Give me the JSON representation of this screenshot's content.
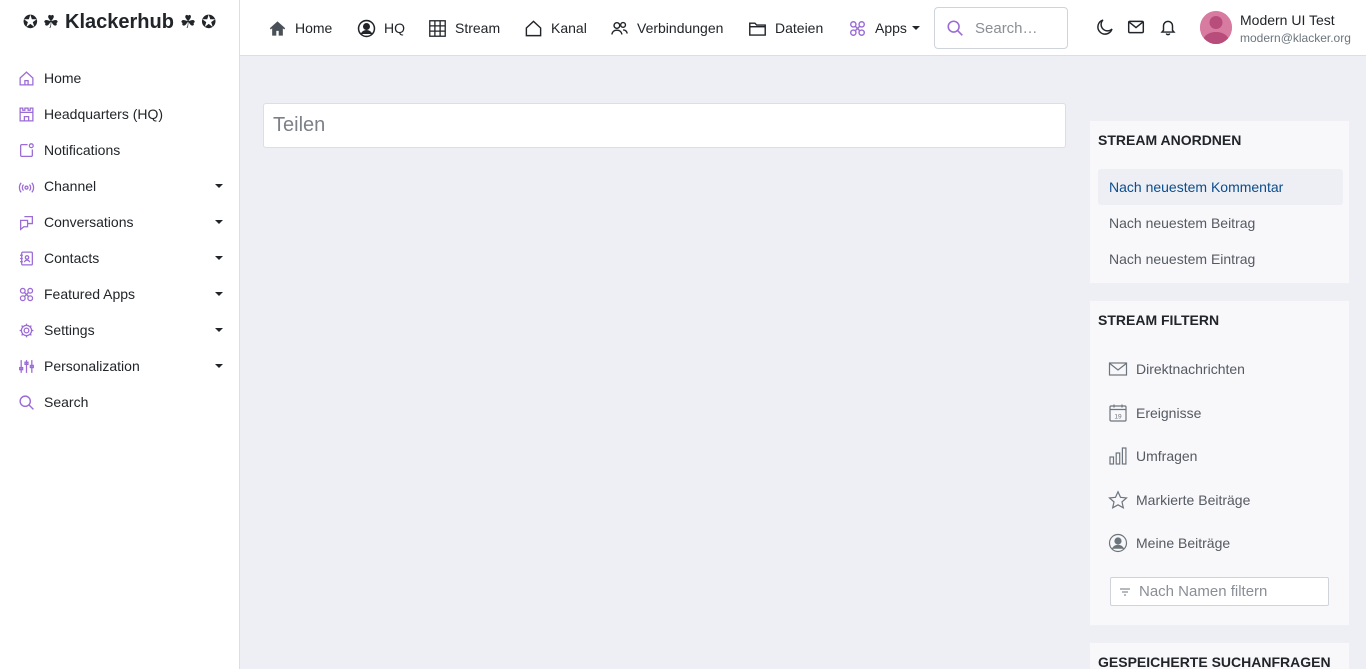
{
  "brand": {
    "symbol_left": "✪ ☘",
    "name": "Klackerhub",
    "symbol_right": "☘ ✪"
  },
  "sidebar": {
    "items": [
      {
        "label": "Home",
        "icon": "home-icon",
        "dropdown": false
      },
      {
        "label": "Headquarters (HQ)",
        "icon": "castle-icon",
        "dropdown": false
      },
      {
        "label": "Notifications",
        "icon": "notification-square-icon",
        "dropdown": false
      },
      {
        "label": "Channel",
        "icon": "broadcast-icon",
        "dropdown": true
      },
      {
        "label": "Conversations",
        "icon": "chat-square-icon",
        "dropdown": true
      },
      {
        "label": "Contacts",
        "icon": "contact-book-icon",
        "dropdown": true
      },
      {
        "label": "Featured Apps",
        "icon": "apps-flower-icon",
        "dropdown": true
      },
      {
        "label": "Settings",
        "icon": "gear-icon",
        "dropdown": true
      },
      {
        "label": "Personalization",
        "icon": "sliders-icon",
        "dropdown": true
      },
      {
        "label": "Search",
        "icon": "search-icon",
        "dropdown": false
      }
    ]
  },
  "topnav": {
    "items": [
      {
        "label": "Home",
        "icon": "home-icon"
      },
      {
        "label": "HQ",
        "icon": "user-circle-icon"
      },
      {
        "label": "Stream",
        "icon": "grid-icon"
      },
      {
        "label": "Kanal",
        "icon": "house-outline-icon"
      },
      {
        "label": "Verbindungen",
        "icon": "people-icon"
      },
      {
        "label": "Dateien",
        "icon": "folder-icon"
      },
      {
        "label": "Apps",
        "icon": "apps-flower-icon"
      }
    ],
    "search_placeholder": "Search…",
    "icons": [
      "moon-icon",
      "envelope-icon",
      "bell-icon"
    ]
  },
  "user": {
    "name": "Modern UI Test",
    "email": "modern@klacker.org"
  },
  "main": {
    "share_placeholder": "Teilen"
  },
  "stream_order": {
    "title": "STREAM ANORDNEN",
    "items": [
      "Nach neuestem Kommentar",
      "Nach neuestem Beitrag",
      "Nach neuestem Eintrag"
    ],
    "active_index": 0
  },
  "stream_filter": {
    "title": "STREAM FILTERN",
    "items": [
      {
        "label": "Direktnachrichten",
        "icon": "envelope-icon"
      },
      {
        "label": "Ereignisse",
        "icon": "calendar-icon"
      },
      {
        "label": "Umfragen",
        "icon": "bar-chart-icon"
      },
      {
        "label": "Markierte Beiträge",
        "icon": "star-icon"
      },
      {
        "label": "Meine Beiträge",
        "icon": "user-circle-icon"
      }
    ],
    "name_filter_placeholder": "Nach Namen filtern"
  },
  "saved_searches": {
    "title": "GESPEICHERTE SUCHANFRAGEN"
  },
  "colors": {
    "accent": "#9b6bd6",
    "active_link": "#0a4d8c",
    "avatar": "#d87ba1"
  }
}
